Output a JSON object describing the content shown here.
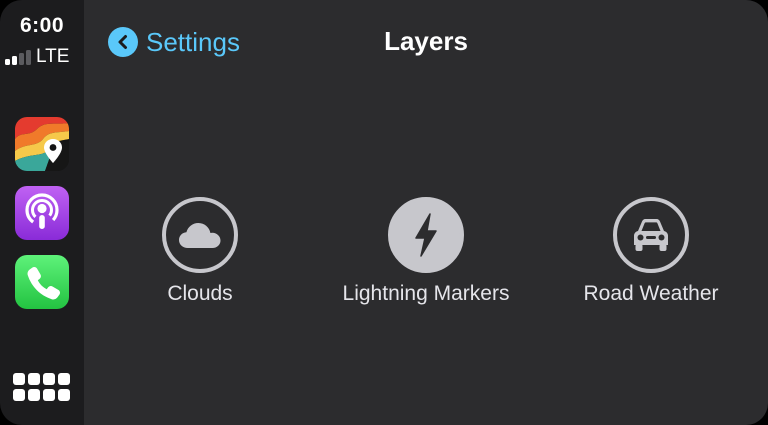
{
  "status": {
    "time": "6:00",
    "network": "LTE",
    "signal_bars_active": 2,
    "signal_bars_total": 4
  },
  "sidebar": {
    "apps": [
      {
        "name": "weather-radar-app",
        "icon": "weather-map-pin-icon"
      },
      {
        "name": "podcasts-app",
        "icon": "podcasts-icon"
      },
      {
        "name": "phone-app",
        "icon": "phone-icon"
      }
    ],
    "home_button_icon": "app-grid-icon"
  },
  "header": {
    "back_label": "Settings",
    "title": "Layers"
  },
  "layers": [
    {
      "label": "Clouds",
      "icon": "cloud-icon",
      "selected": false
    },
    {
      "label": "Lightning Markers",
      "icon": "lightning-icon",
      "selected": true
    },
    {
      "label": "Road Weather",
      "icon": "car-icon",
      "selected": false
    }
  ],
  "colors": {
    "accent": "#5ac8fa",
    "sidebar_bg": "#1c1c1e",
    "main_bg": "#2c2c2e",
    "icon_gray": "#c7c7cc",
    "podcasts": "#a347e6",
    "phone": "#34c759"
  }
}
